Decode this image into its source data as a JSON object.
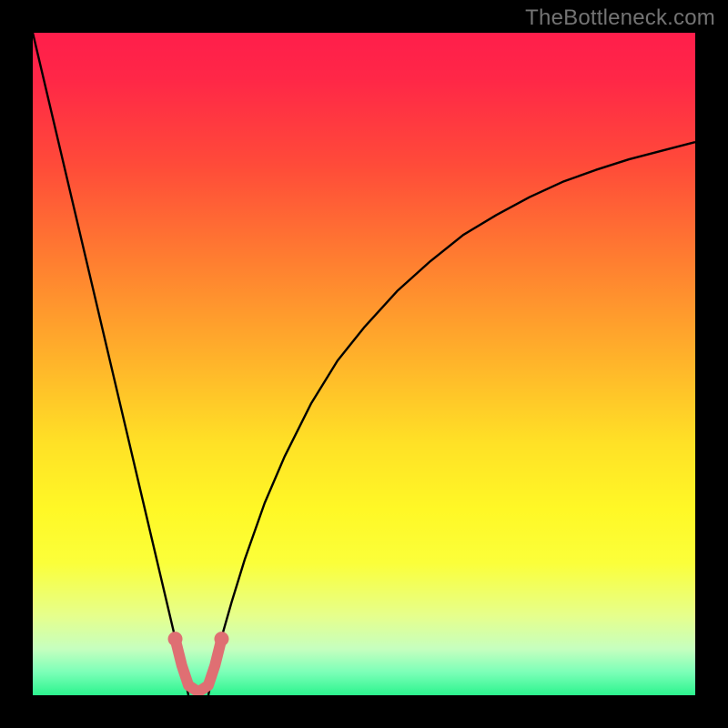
{
  "watermark": "TheBottleneck.com",
  "chart_data": {
    "type": "line",
    "title": "",
    "xlabel": "",
    "ylabel": "",
    "xlim": [
      0,
      1
    ],
    "ylim": [
      0,
      1
    ],
    "background_gradient": {
      "stops": [
        {
          "offset": 0.0,
          "color": "#ff1e4b"
        },
        {
          "offset": 0.07,
          "color": "#ff2747"
        },
        {
          "offset": 0.2,
          "color": "#ff4b39"
        },
        {
          "offset": 0.35,
          "color": "#ff8030"
        },
        {
          "offset": 0.5,
          "color": "#ffb52a"
        },
        {
          "offset": 0.62,
          "color": "#ffe126"
        },
        {
          "offset": 0.72,
          "color": "#fff826"
        },
        {
          "offset": 0.8,
          "color": "#fbff3a"
        },
        {
          "offset": 0.88,
          "color": "#e6ff8c"
        },
        {
          "offset": 0.93,
          "color": "#c6ffbf"
        },
        {
          "offset": 0.965,
          "color": "#7cffb8"
        },
        {
          "offset": 1.0,
          "color": "#2cf48e"
        }
      ]
    },
    "series": [
      {
        "name": "curve-left",
        "color": "#000000",
        "width": 2.4,
        "x": [
          0.0,
          0.02,
          0.04,
          0.06,
          0.08,
          0.1,
          0.12,
          0.14,
          0.16,
          0.18,
          0.2,
          0.21,
          0.22,
          0.23,
          0.235
        ],
        "y": [
          1.0,
          0.915,
          0.83,
          0.745,
          0.66,
          0.575,
          0.49,
          0.405,
          0.32,
          0.235,
          0.15,
          0.1075,
          0.065,
          0.0225,
          0.0
        ]
      },
      {
        "name": "curve-right",
        "color": "#000000",
        "width": 2.4,
        "x": [
          0.265,
          0.28,
          0.3,
          0.32,
          0.35,
          0.38,
          0.42,
          0.46,
          0.5,
          0.55,
          0.6,
          0.65,
          0.7,
          0.75,
          0.8,
          0.85,
          0.9,
          0.95,
          1.0
        ],
        "y": [
          0.0,
          0.07,
          0.14,
          0.205,
          0.29,
          0.36,
          0.44,
          0.505,
          0.555,
          0.61,
          0.655,
          0.695,
          0.725,
          0.752,
          0.775,
          0.793,
          0.809,
          0.822,
          0.835
        ]
      },
      {
        "name": "u-shape-highlight",
        "color": "#df6f73",
        "width": 12,
        "linecap": "round",
        "x": [
          0.215,
          0.225,
          0.235,
          0.25,
          0.265,
          0.275,
          0.285
        ],
        "y": [
          0.085,
          0.045,
          0.015,
          0.005,
          0.015,
          0.045,
          0.085
        ]
      }
    ]
  }
}
